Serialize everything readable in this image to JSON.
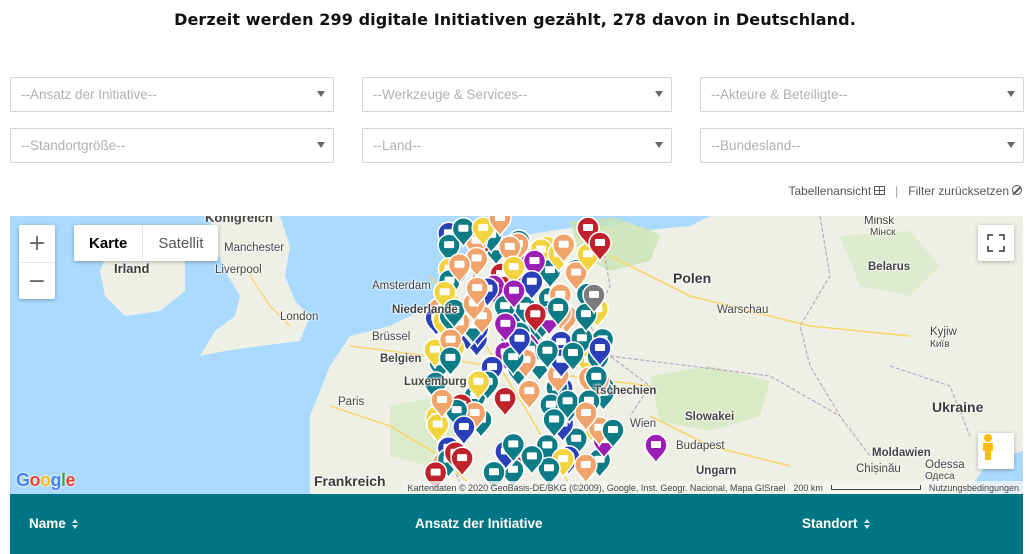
{
  "headline": "Derzeit werden 299 digitale Initiativen gezählt, 278 davon in Deutschland.",
  "filters": [
    {
      "placeholder": "--Ansatz der Initiative--"
    },
    {
      "placeholder": "--Werkzeuge & Services--"
    },
    {
      "placeholder": "--Akteure & Beteiligte--"
    },
    {
      "placeholder": "--Standortgröße--"
    },
    {
      "placeholder": "--Land--"
    },
    {
      "placeholder": "--Bundesland--"
    }
  ],
  "tools": {
    "table_view": "Tabellenansicht",
    "reset_filter": "Filter zurücksetzen"
  },
  "map": {
    "type_map": "Karte",
    "type_satellite": "Satellit",
    "zoom_in": "+",
    "zoom_out": "−",
    "google": "Google",
    "attribution": "Kartendaten © 2020 GeoBasis-DE/BKG (©2009), Google, Inst. Geogr. Nacional, Mapa GISrael",
    "scale": "200 km",
    "terms": "Nutzungsbedingungen",
    "labels": {
      "koenigreich": "Königreich",
      "manchester": "Manchester",
      "irland": "Irland",
      "liverpool": "Liverpool",
      "london": "London",
      "amsterdam": "Amsterdam",
      "niederlande": "Niederlande",
      "bruessel": "Brüssel",
      "belgien": "Belgien",
      "luxemburg": "Luxemburg",
      "paris": "Paris",
      "frankreich": "Frankreich",
      "polen": "Polen",
      "warschau": "Warschau",
      "minsk": "Minsk",
      "minsk_cyr": "Мінск",
      "belarus": "Belarus",
      "kyiv": "Kyjiw",
      "kyiv_cyr": "Київ",
      "ukraine": "Ukraine",
      "tschechien": "Tschechien",
      "slowakei": "Slowakei",
      "wien": "Wien",
      "budapest": "Budapest",
      "ungarn": "Ungarn",
      "moldawien": "Moldawien",
      "chisinau": "Chișinău",
      "odessa": "Odessa",
      "odessa_cyr": "Одеса"
    }
  },
  "table": {
    "col_name": "Name",
    "col_ansatz": "Ansatz der Initiative",
    "col_standort": "Standort"
  },
  "colors": {
    "header_teal": "#007684",
    "marker_teal": "#0e7c86",
    "marker_orange": "#f0a36b",
    "marker_yellow": "#f2d43f",
    "marker_blue": "#2a3fb8",
    "marker_red": "#c0222c",
    "marker_purple": "#9b1fb5",
    "marker_gray": "#7b7b7b"
  }
}
